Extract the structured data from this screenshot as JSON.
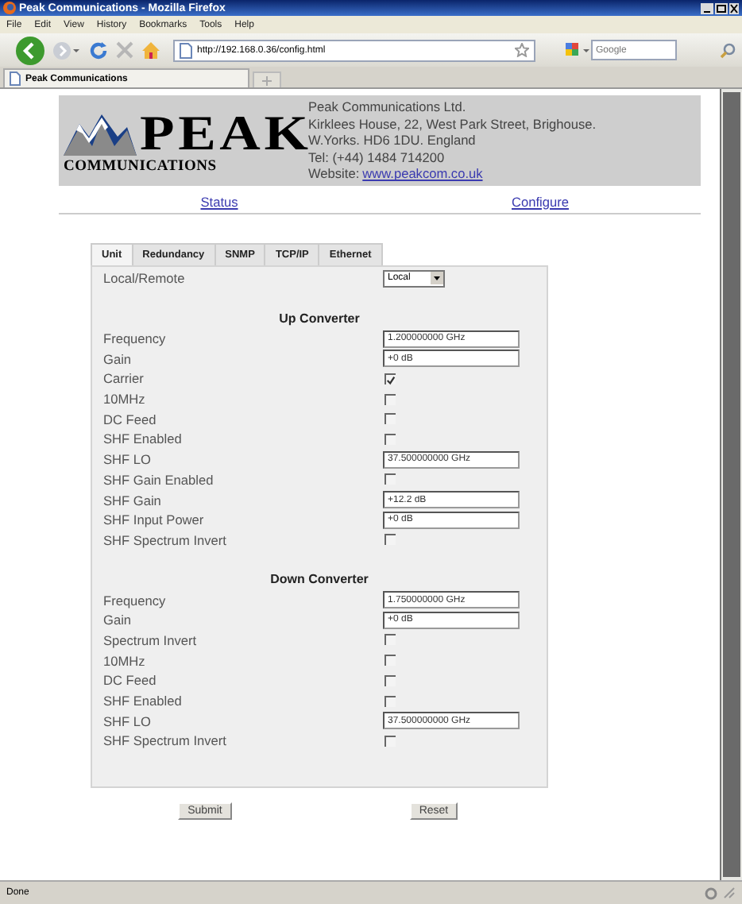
{
  "window": {
    "title": "Peak Communications - Mozilla Firefox"
  },
  "menu": [
    "File",
    "Edit",
    "View",
    "History",
    "Bookmarks",
    "Tools",
    "Help"
  ],
  "toolbar": {
    "url": "http://192.168.0.36/config.html",
    "search_placeholder": "Google"
  },
  "browser_tabs": [
    {
      "label": "Peak Communications",
      "selected": true
    }
  ],
  "header": {
    "logo_name": "PEAK",
    "logo_tagline": "COMMUNICATIONS",
    "address": [
      "Peak Communications Ltd.",
      "Kirklees House, 22, West Park Street, Brighouse.",
      "W.Yorks. HD6 1DU. England",
      "Tel: (+44) 1484 714200"
    ],
    "website_label": "Website:",
    "website_link": "www.peakcom.co.uk"
  },
  "nav_links": [
    "Status",
    "Configure"
  ],
  "form_tabs": [
    {
      "label": "Unit",
      "selected": true
    },
    {
      "label": "Redundancy",
      "selected": false
    },
    {
      "label": "SNMP",
      "selected": false
    },
    {
      "label": "TCP/IP",
      "selected": false
    },
    {
      "label": "Ethernet",
      "selected": false
    }
  ],
  "local_remote": {
    "label": "Local/Remote",
    "value": "Local"
  },
  "sections": [
    {
      "heading": "Up Converter",
      "rows": [
        {
          "kind": "text",
          "label": "Frequency",
          "value": "1.200000000 GHz"
        },
        {
          "kind": "text",
          "label": "Gain",
          "value": "+0 dB"
        },
        {
          "kind": "check",
          "label": "Carrier",
          "checked": true
        },
        {
          "kind": "check",
          "label": "10MHz",
          "checked": false
        },
        {
          "kind": "check",
          "label": "DC Feed",
          "checked": false
        },
        {
          "kind": "check",
          "label": "SHF Enabled",
          "checked": false
        },
        {
          "kind": "text",
          "label": "SHF LO",
          "value": "37.500000000 GHz"
        },
        {
          "kind": "check",
          "label": "SHF Gain Enabled",
          "checked": false
        },
        {
          "kind": "text",
          "label": "SHF Gain",
          "value": "+12.2 dB"
        },
        {
          "kind": "text",
          "label": "SHF Input Power",
          "value": "+0 dB"
        },
        {
          "kind": "check",
          "label": "SHF Spectrum Invert",
          "checked": false
        }
      ]
    },
    {
      "heading": "Down Converter",
      "rows": [
        {
          "kind": "text",
          "label": "Frequency",
          "value": "1.750000000 GHz"
        },
        {
          "kind": "text",
          "label": "Gain",
          "value": "+0 dB"
        },
        {
          "kind": "check",
          "label": "Spectrum Invert",
          "checked": false
        },
        {
          "kind": "check",
          "label": "10MHz",
          "checked": false
        },
        {
          "kind": "check",
          "label": "DC Feed",
          "checked": false
        },
        {
          "kind": "check",
          "label": "SHF Enabled",
          "checked": false
        },
        {
          "kind": "text",
          "label": "SHF LO",
          "value": "37.500000000 GHz"
        },
        {
          "kind": "check",
          "label": "SHF Spectrum Invert",
          "checked": false
        }
      ]
    }
  ],
  "buttons": [
    "Submit",
    "Reset"
  ],
  "status_bar": "Done"
}
